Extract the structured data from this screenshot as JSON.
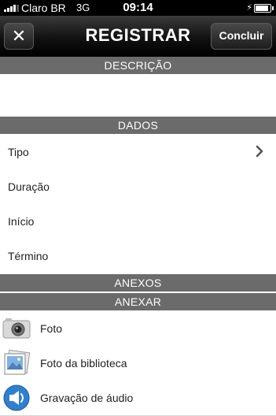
{
  "status_bar": {
    "carrier": "Claro BR",
    "network": "3G",
    "time": "09:14"
  },
  "nav": {
    "title": "REGISTRAR",
    "close_label": "✕",
    "done_label": "Concluir"
  },
  "sections": {
    "descricao": "DESCRIÇÃO",
    "dados": "DADOS",
    "anexos": "ANEXOS",
    "anexar": "ANEXAR"
  },
  "dados_rows": [
    "Tipo",
    "Duração",
    "Início",
    "Término"
  ],
  "anexar_rows": [
    {
      "label": "Foto",
      "icon": "camera-icon"
    },
    {
      "label": "Foto da biblioteca",
      "icon": "photo-library-icon"
    },
    {
      "label": "Gravação de áudio",
      "icon": "microphone-icon"
    }
  ]
}
